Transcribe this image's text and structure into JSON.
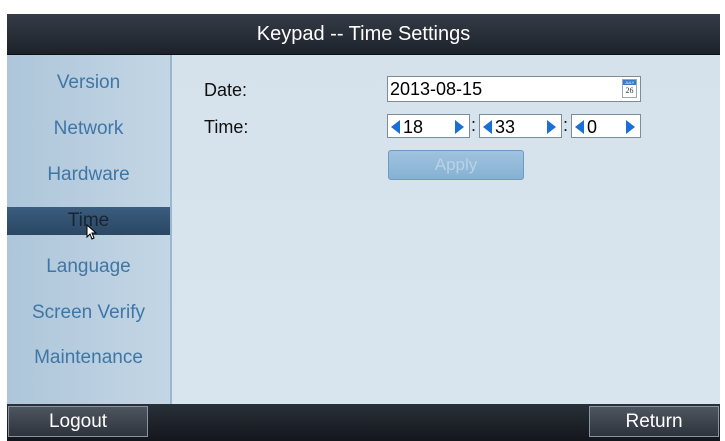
{
  "title": "Keypad -- Time Settings",
  "sidebar": {
    "items": [
      {
        "label": "Version"
      },
      {
        "label": "Network"
      },
      {
        "label": "Hardware"
      },
      {
        "label": "Time"
      },
      {
        "label": "Language"
      },
      {
        "label": "Screen Verify"
      },
      {
        "label": "Maintenance"
      }
    ],
    "active": "Time"
  },
  "form": {
    "date_label": "Date:",
    "date_value": "2013-08-15",
    "calendar_icon": {
      "name": "calendar-icon",
      "month": "JULY",
      "day": "26"
    },
    "time_label": "Time:",
    "hour": "18",
    "minute": "33",
    "second": "0",
    "separator": ":",
    "apply_label": "Apply"
  },
  "footer": {
    "logout_label": "Logout",
    "return_label": "Return"
  },
  "colors": {
    "title_bar": "#1d222a",
    "sidebar_bg": "#b9cfe1",
    "sidebar_text": "#3f76a6",
    "active_item": "#2b4764",
    "content_bg": "#d7e3ed",
    "arrow": "#1a6fd6",
    "apply_disabled": "#8fb7d8"
  }
}
